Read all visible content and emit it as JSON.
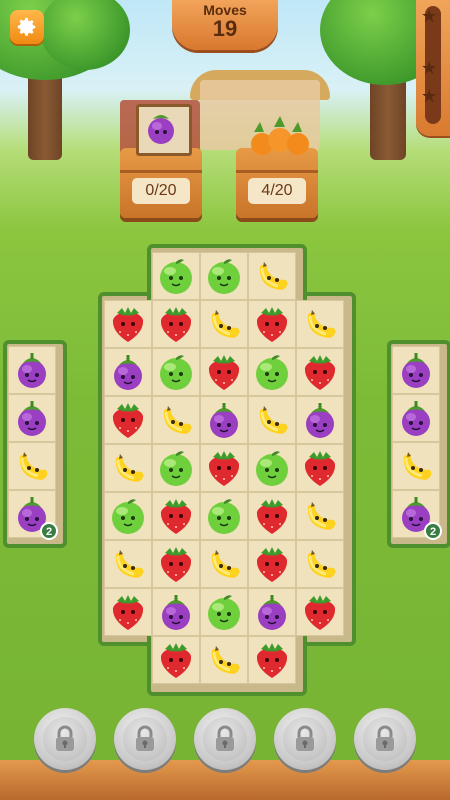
{
  "hud": {
    "moves_label": "Moves",
    "moves_value": "19",
    "settings_icon": "gear-icon",
    "star_meter_stars": 3,
    "star_meter_progress": 0.0
  },
  "goals": [
    {
      "fruit": "eggplant",
      "count": "0/20"
    },
    {
      "fruit": "carrot",
      "count": "4/20"
    }
  ],
  "colors": {
    "accent": "#f08a12",
    "board_border": "#4f8f2e",
    "tile": "#efe2bd"
  },
  "board": {
    "center_rows": [
      [
        "",
        "apple",
        "apple",
        "banana",
        ""
      ],
      [
        "strawberry",
        "strawberry",
        "banana",
        "strawberry",
        "banana"
      ],
      [
        "eggplant",
        "apple",
        "strawberry",
        "apple",
        "strawberry"
      ],
      [
        "strawberry",
        "banana",
        "eggplant",
        "banana",
        "eggplant"
      ],
      [
        "banana",
        "apple",
        "strawberry",
        "apple",
        "strawberry"
      ],
      [
        "apple",
        "strawberry",
        "apple",
        "strawberry",
        "banana"
      ],
      [
        "banana",
        "strawberry",
        "banana",
        "strawberry",
        "banana"
      ],
      [
        "strawberry",
        "eggplant",
        "apple",
        "eggplant",
        "strawberry"
      ],
      [
        "",
        "strawberry",
        "banana",
        "strawberry",
        ""
      ]
    ],
    "left_column": [
      "eggplant",
      "eggplant",
      "banana",
      "eggplant"
    ],
    "right_column": [
      "eggplant",
      "eggplant",
      "banana",
      "eggplant"
    ],
    "left_badge": "2",
    "right_badge": "2"
  },
  "boosters": [
    {
      "name": "booster-1",
      "icon": "lock-icon",
      "locked": true
    },
    {
      "name": "booster-2",
      "icon": "lock-icon",
      "locked": true
    },
    {
      "name": "booster-3",
      "icon": "lock-icon",
      "locked": true
    },
    {
      "name": "booster-4",
      "icon": "lock-icon",
      "locked": true
    },
    {
      "name": "booster-5",
      "icon": "lock-icon",
      "locked": true
    }
  ]
}
